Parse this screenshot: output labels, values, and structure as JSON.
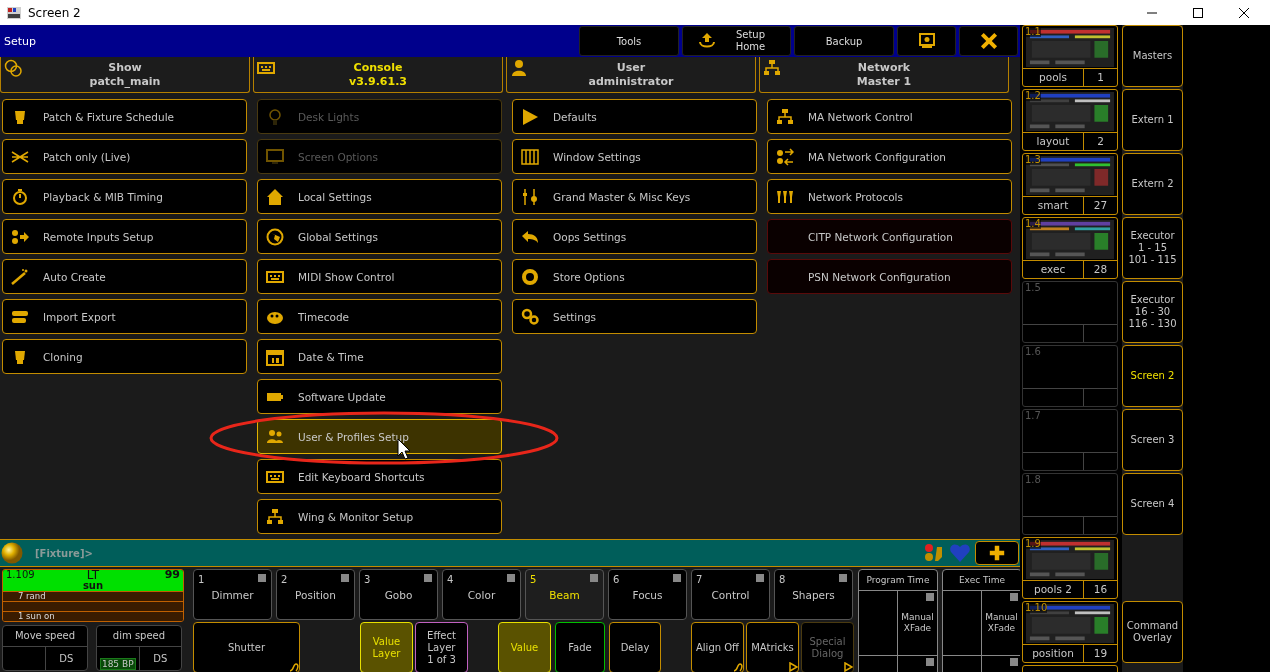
{
  "window": {
    "title": "Screen 2"
  },
  "menu_bar": {
    "title": "Setup",
    "buttons": [
      {
        "label": "Tools",
        "kind": "text"
      },
      {
        "label": "Setup Home",
        "kind": "home"
      },
      {
        "label": "Backup",
        "kind": "text"
      },
      {
        "kind": "screen"
      },
      {
        "kind": "close"
      }
    ]
  },
  "header_tabs": [
    {
      "title": "Show",
      "value": "patch_main",
      "selected": false
    },
    {
      "title": "Console",
      "value": "v3.9.61.3",
      "selected": true
    },
    {
      "title": "User",
      "value": "administrator",
      "selected": false
    },
    {
      "title": "Network",
      "value": "Master 1",
      "selected": false
    }
  ],
  "setup_columns": [
    {
      "items": [
        {
          "label": "Patch & Fixture Schedule",
          "kind": "standard",
          "disabled": false,
          "selected": false
        },
        {
          "label": "Patch only (Live)",
          "kind": "standard",
          "disabled": false,
          "selected": false
        },
        {
          "label": "Playback & MIB Timing",
          "kind": "standard",
          "disabled": false,
          "selected": false
        },
        {
          "label": "Remote Inputs Setup",
          "kind": "standard",
          "disabled": false,
          "selected": false
        },
        {
          "label": "Auto Create",
          "kind": "standard",
          "disabled": false,
          "selected": false
        },
        {
          "label": "Import Export",
          "kind": "standard",
          "disabled": false,
          "selected": false
        },
        {
          "label": "Cloning",
          "kind": "standard",
          "disabled": false,
          "selected": false
        }
      ]
    },
    {
      "items": [
        {
          "label": "Desk Lights",
          "kind": "standard",
          "disabled": true,
          "selected": false
        },
        {
          "label": "Screen Options",
          "kind": "standard",
          "disabled": true,
          "selected": false
        },
        {
          "label": "Local Settings",
          "kind": "standard",
          "disabled": false,
          "selected": false
        },
        {
          "label": "Global Settings",
          "kind": "standard",
          "disabled": false,
          "selected": false
        },
        {
          "label": "MIDI Show Control",
          "kind": "standard",
          "disabled": false,
          "selected": false
        },
        {
          "label": "Timecode",
          "kind": "standard",
          "disabled": false,
          "selected": false
        },
        {
          "label": "Date & Time",
          "kind": "standard",
          "disabled": false,
          "selected": false
        },
        {
          "label": "Software Update",
          "kind": "standard",
          "disabled": false,
          "selected": false
        },
        {
          "label": "User & Profiles Setup",
          "kind": "standard",
          "disabled": false,
          "selected": true
        },
        {
          "label": "Edit Keyboard Shortcuts",
          "kind": "standard",
          "disabled": false,
          "selected": false
        },
        {
          "label": "Wing & Monitor Setup",
          "kind": "standard",
          "disabled": false,
          "selected": false
        }
      ]
    },
    {
      "items": [
        {
          "label": "Defaults",
          "kind": "standard",
          "disabled": false,
          "selected": false
        },
        {
          "label": "Window Settings",
          "kind": "standard",
          "disabled": false,
          "selected": false
        },
        {
          "label": "Grand Master & Misc Keys",
          "kind": "standard",
          "disabled": false,
          "selected": false
        },
        {
          "label": "Oops Settings",
          "kind": "standard",
          "disabled": false,
          "selected": false
        },
        {
          "label": "Store Options",
          "kind": "standard",
          "disabled": false,
          "selected": false
        },
        {
          "label": "Settings",
          "kind": "standard",
          "disabled": false,
          "selected": false
        }
      ]
    },
    {
      "items": [
        {
          "label": "MA Network Control",
          "kind": "standard",
          "disabled": false,
          "selected": false
        },
        {
          "label": "MA Network Configuration",
          "kind": "standard",
          "disabled": false,
          "selected": false
        },
        {
          "label": "Network Protocols",
          "kind": "standard",
          "disabled": false,
          "selected": false
        },
        {
          "label": "CITP Network Configuration",
          "kind": "unavailable",
          "disabled": false,
          "selected": false
        },
        {
          "label": "PSN Network Configuration",
          "kind": "unavailable",
          "disabled": false,
          "selected": false
        }
      ]
    }
  ],
  "command_line": {
    "prompt": "[Fixture]>"
  },
  "executor": {
    "number": "1.109",
    "name": "LT",
    "value": "99",
    "cue": "sun",
    "row_1": "7 rand",
    "row_3": "1 sun on"
  },
  "speed_masters": [
    {
      "label": "Move speed",
      "mode": "DS"
    },
    {
      "label": "dim speed",
      "mode": "DS",
      "value": "185 BP"
    }
  ],
  "feature_buttons": [
    {
      "number": "1",
      "label": "Dimmer",
      "selected": false
    },
    {
      "number": "2",
      "label": "Position",
      "selected": false
    },
    {
      "number": "3",
      "label": "Gobo",
      "selected": false
    },
    {
      "number": "4",
      "label": "Color",
      "selected": false
    },
    {
      "number": "5",
      "label": "Beam",
      "selected": true
    },
    {
      "number": "6",
      "label": "Focus",
      "selected": false
    },
    {
      "number": "7",
      "label": "Control",
      "selected": false
    },
    {
      "number": "8",
      "label": "Shapers",
      "selected": false
    }
  ],
  "action_buttons": [
    {
      "label": "Shutter",
      "kind": "shutter"
    },
    {
      "label": "Value Layer",
      "kind": "layer-on"
    },
    {
      "label": "Effect Layer",
      "detail": "1 of 3",
      "kind": "layer"
    },
    {
      "label": "Value",
      "kind": "value"
    },
    {
      "label": "Fade",
      "kind": "fade"
    },
    {
      "label": "Delay",
      "kind": "delay"
    },
    {
      "label": "Align Off",
      "kind": "align"
    },
    {
      "label": "MAtricks",
      "kind": "tool"
    },
    {
      "label": "Special Dialog",
      "kind": "disabled"
    }
  ],
  "time_panels": [
    {
      "title": "Program Time",
      "mode": "Manual XFade"
    },
    {
      "title": "Exec Time",
      "mode": "Manual XFade"
    }
  ],
  "views": [
    {
      "number": "1.1",
      "name": "pools",
      "count": "1",
      "kind": "stored"
    },
    {
      "number": "1.2",
      "name": "layout",
      "count": "2",
      "kind": "stored"
    },
    {
      "number": "1.3",
      "name": "smart",
      "count": "27",
      "kind": "stored"
    },
    {
      "number": "1.4",
      "name": "exec",
      "count": "28",
      "kind": "stored"
    },
    {
      "number": "1.5",
      "kind": "empty"
    },
    {
      "number": "1.6",
      "kind": "empty"
    },
    {
      "number": "1.7",
      "kind": "empty"
    },
    {
      "number": "1.8",
      "kind": "empty"
    },
    {
      "number": "1.9",
      "name": "pools 2",
      "count": "16",
      "kind": "stored"
    },
    {
      "number": "1.10",
      "name": "position",
      "count": "19",
      "kind": "stored"
    }
  ],
  "screen_buttons": [
    {
      "label": "Masters",
      "selected": false
    },
    {
      "label": "Extern 1",
      "selected": false
    },
    {
      "label": "Extern 2",
      "selected": false
    },
    {
      "label": "Executor",
      "detail": "1 - 15",
      "extra": "101 - 115",
      "selected": false
    },
    {
      "label": "Executor",
      "detail": "16 - 30",
      "extra": "116 - 130",
      "selected": false
    },
    {
      "label": "Screen 2",
      "selected": true
    },
    {
      "label": "Screen 3",
      "selected": false
    },
    {
      "label": "Screen 4",
      "selected": false
    }
  ],
  "command_overlay": {
    "label": "Command Overlay"
  }
}
